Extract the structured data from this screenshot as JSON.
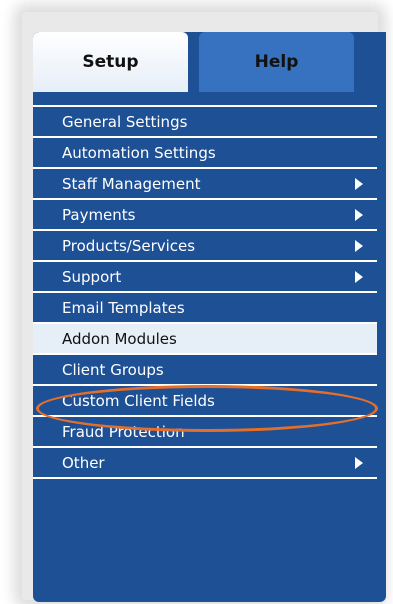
{
  "tabs": [
    {
      "label": "Setup",
      "active": true
    },
    {
      "label": "Help",
      "active": false
    }
  ],
  "menu": {
    "items": [
      {
        "label": "General Settings",
        "has_submenu": false
      },
      {
        "label": "Automation Settings",
        "has_submenu": false
      },
      {
        "label": "Staff Management",
        "has_submenu": true
      },
      {
        "label": "Payments",
        "has_submenu": true
      },
      {
        "label": "Products/Services",
        "has_submenu": true
      },
      {
        "label": "Support",
        "has_submenu": true
      },
      {
        "label": "Email Templates",
        "has_submenu": false
      },
      {
        "label": "Addon Modules",
        "has_submenu": false,
        "highlighted": true
      },
      {
        "label": "Client Groups",
        "has_submenu": false
      },
      {
        "label": "Custom Client Fields",
        "has_submenu": false
      },
      {
        "label": "Fraud Protection",
        "has_submenu": false
      },
      {
        "label": "Other",
        "has_submenu": true
      }
    ]
  },
  "colors": {
    "panel": "#1e5095",
    "tab_inactive": "#3672bf",
    "highlight_ring": "#e56f2a"
  },
  "icons": {
    "submenu_arrow": "arrow-right-icon"
  }
}
